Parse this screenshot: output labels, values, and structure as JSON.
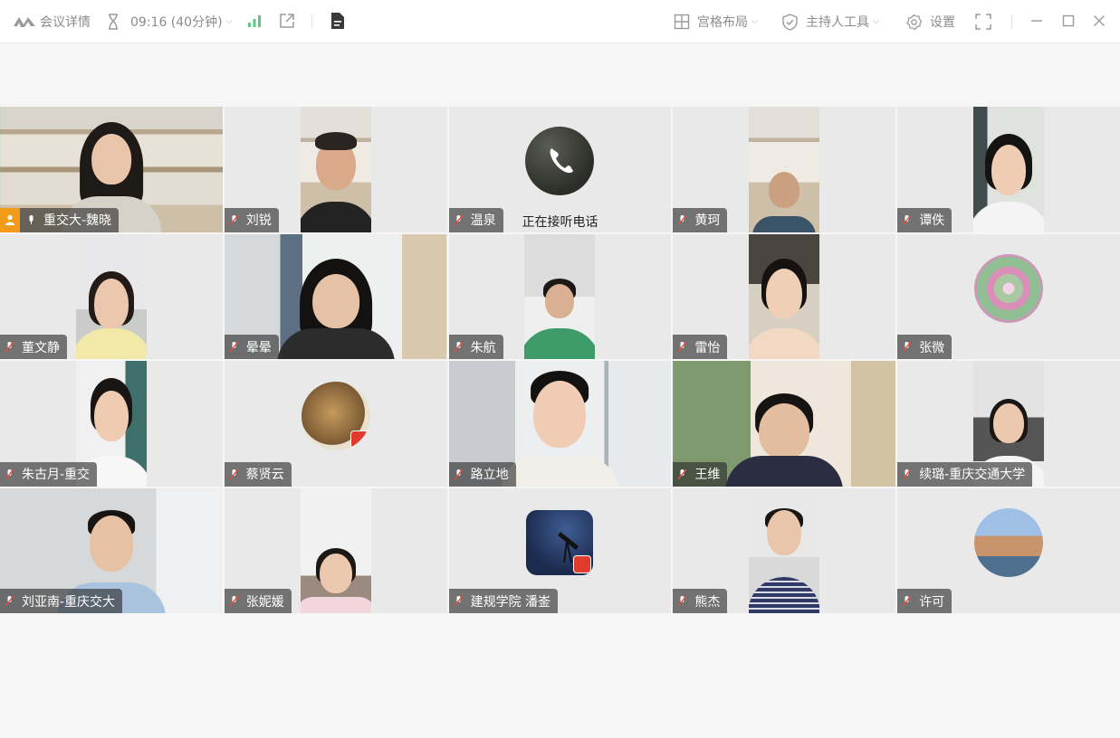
{
  "toolbar": {
    "meeting_info_label": "会议详情",
    "timer": "09:16 (40分钟)",
    "layout_label": "宫格布局",
    "host_tools_label": "主持人工具",
    "settings_label": "设置"
  },
  "call_status": "正在接听电话",
  "participants": [
    {
      "name": "重交大-魏晓"
    },
    {
      "name": "刘锐"
    },
    {
      "name": "温泉"
    },
    {
      "name": "黄珂"
    },
    {
      "name": "谭佚"
    },
    {
      "name": "董文静"
    },
    {
      "name": "晕晕"
    },
    {
      "name": "朱航"
    },
    {
      "name": "雷怡"
    },
    {
      "name": "张微"
    },
    {
      "name": "朱古月-重交"
    },
    {
      "name": "蔡贤云"
    },
    {
      "name": "路立地"
    },
    {
      "name": "王维"
    },
    {
      "name": "续璐-重庆交通大学"
    },
    {
      "name": "刘亚南-重庆交大"
    },
    {
      "name": "张妮媛"
    },
    {
      "name": "建规学院 潘崟"
    },
    {
      "name": "熊杰"
    },
    {
      "name": "许可"
    }
  ],
  "colors": {
    "accent_active": "#3cc37a",
    "host_badge": "#f29a19",
    "signal": "#5ec48a"
  }
}
